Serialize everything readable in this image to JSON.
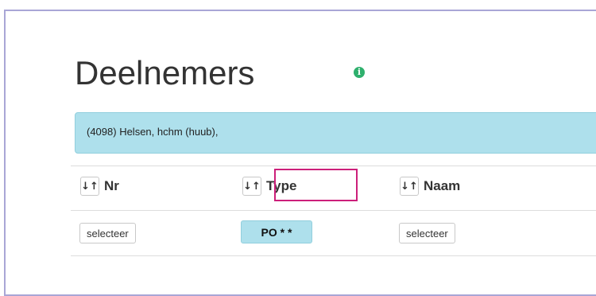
{
  "page": {
    "title": "Deelnemers",
    "info_icon": "info-icon"
  },
  "alert": {
    "text": "(4098) Helsen, hchm (huub),"
  },
  "table": {
    "columns": [
      {
        "label": "Nr",
        "sort_icon": "sort-icon",
        "sort_glyph": "↓↑"
      },
      {
        "label": "Type",
        "sort_icon": "sort-icon",
        "sort_glyph": "↓↑",
        "highlighted": true
      },
      {
        "label": "Naam",
        "sort_icon": "sort-icon",
        "sort_glyph": "↓↑"
      }
    ],
    "row": {
      "nr_button": "selecteer",
      "type_button": "PO * *",
      "naam_button": "selecteer"
    }
  },
  "colors": {
    "alert_bg": "#aee0ec",
    "highlight_border": "#cc1f7a",
    "info_icon": "#2fb06d",
    "frame_border": "#a9a6d6"
  }
}
